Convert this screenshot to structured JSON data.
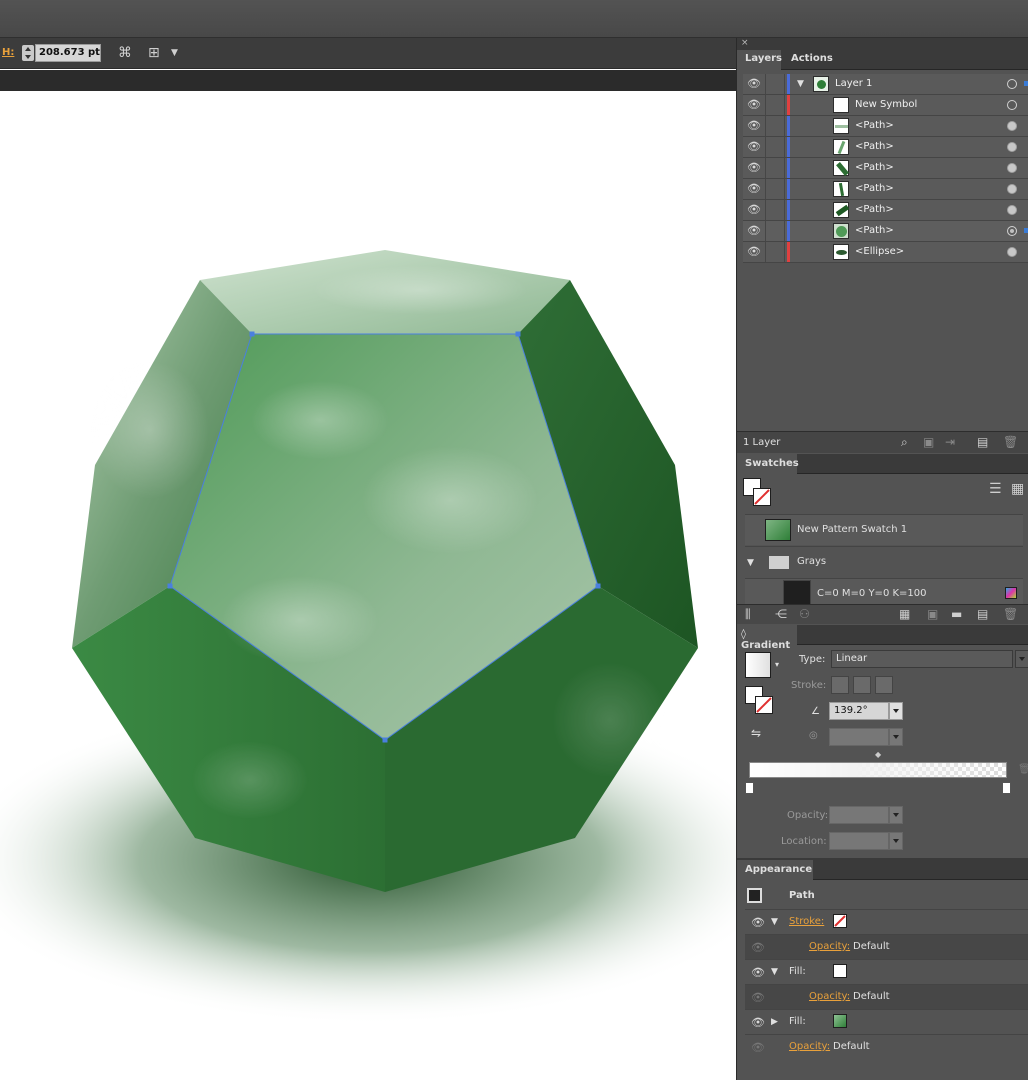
{
  "control_bar": {
    "h_label": "H:",
    "h_value": "208.673 pt",
    "icons": [
      "transform-icon",
      "isolate-icon"
    ]
  },
  "layers_panel": {
    "tabs": [
      "Layers",
      "Actions"
    ],
    "rows": [
      {
        "name": "Layer 1",
        "color": "#4a6bd8",
        "thumb": "green-blob",
        "expanded": true
      },
      {
        "name": "New Symbol",
        "color": "#e04040",
        "thumb": "blank"
      },
      {
        "name": "<Path>",
        "color": "#4a6bd8",
        "thumb": "light-stroke"
      },
      {
        "name": "<Path>",
        "color": "#4a6bd8",
        "thumb": "green-stroke"
      },
      {
        "name": "<Path>",
        "color": "#4a6bd8",
        "thumb": "green-stroke"
      },
      {
        "name": "<Path>",
        "color": "#4a6bd8",
        "thumb": "green-stroke"
      },
      {
        "name": "<Path>",
        "color": "#4a6bd8",
        "thumb": "green-stroke"
      },
      {
        "name": "<Path>",
        "color": "#4a6bd8",
        "thumb": "green-blob",
        "selected": true
      },
      {
        "name": "<Ellipse>",
        "color": "#e04040",
        "thumb": "ellipse"
      }
    ],
    "footer_label": "1 Layer"
  },
  "swatches_panel": {
    "title": "Swatches",
    "items": [
      {
        "label": "New Pattern Swatch 1",
        "kind": "pattern"
      },
      {
        "label": "Grays",
        "kind": "folder"
      },
      {
        "label": "C=0 M=0 Y=0 K=100",
        "kind": "color"
      }
    ]
  },
  "gradient_panel": {
    "title": "Gradient",
    "type_label": "Type:",
    "type_value": "Linear",
    "stroke_label": "Stroke:",
    "angle_value": "139.2°",
    "opacity_label": "Opacity:",
    "location_label": "Location:"
  },
  "appearance_panel": {
    "title": "Appearance",
    "object": "Path",
    "rows": [
      {
        "label": "Stroke:",
        "value": "",
        "type": "stroke"
      },
      {
        "label": "Opacity:",
        "value": "Default",
        "type": "sub"
      },
      {
        "label": "Fill:",
        "value": "",
        "type": "fill-white"
      },
      {
        "label": "Opacity:",
        "value": "Default",
        "type": "sub"
      },
      {
        "label": "Fill:",
        "value": "",
        "type": "fill-pattern"
      },
      {
        "label": "Opacity:",
        "value": "Default",
        "type": "opacity"
      }
    ]
  },
  "colors": {
    "panel_bg": "#535353",
    "accent_orange": "#e9a13b",
    "layer_blue": "#4a6bd8",
    "layer_red": "#e04040",
    "gem_green": "#2f7f38"
  }
}
